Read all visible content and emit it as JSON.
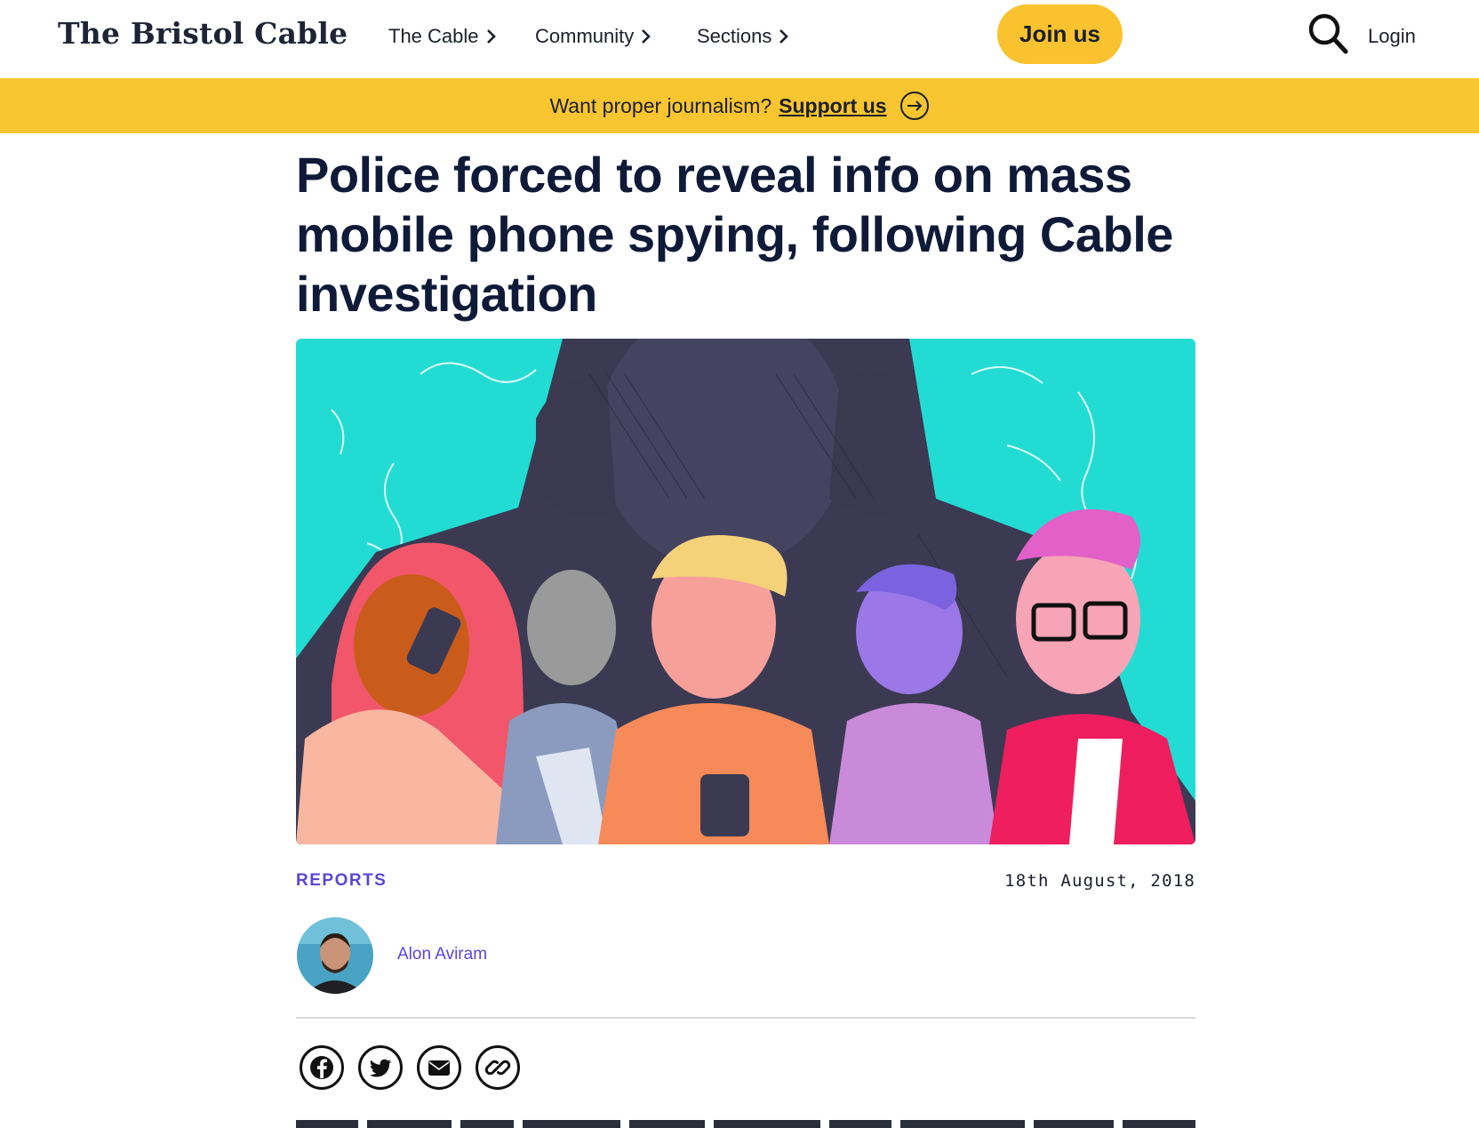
{
  "header": {
    "logo": "The Bristol Cable",
    "nav": [
      {
        "label": "The Cable"
      },
      {
        "label": "Community"
      },
      {
        "label": "Sections"
      }
    ],
    "join_label": "Join us",
    "login_label": "Login",
    "icons": {
      "search": "search-icon",
      "chevron": "chevron-right-icon"
    }
  },
  "support_bar": {
    "text": "Want proper journalism?",
    "link": "Support us",
    "icon": "arrow-right-circle-icon",
    "background": "#f9c530"
  },
  "article": {
    "headline": "Police forced to reveal info on mass mobile phone spying, following Cable investigation",
    "section": "REPORTS",
    "date": "18th August, 2018",
    "author": "Alon Aviram",
    "hero_image": "illustration-people-on-phones-shadow-figure",
    "share": [
      {
        "icon": "facebook-icon"
      },
      {
        "icon": "twitter-icon"
      },
      {
        "icon": "email-icon"
      },
      {
        "icon": "link-icon"
      }
    ]
  },
  "colors": {
    "accent_yellow": "#f9c22e",
    "accent_purple": "#5b45d6",
    "headline_navy": "#0f1a38",
    "hero_teal": "#22dcd4"
  }
}
